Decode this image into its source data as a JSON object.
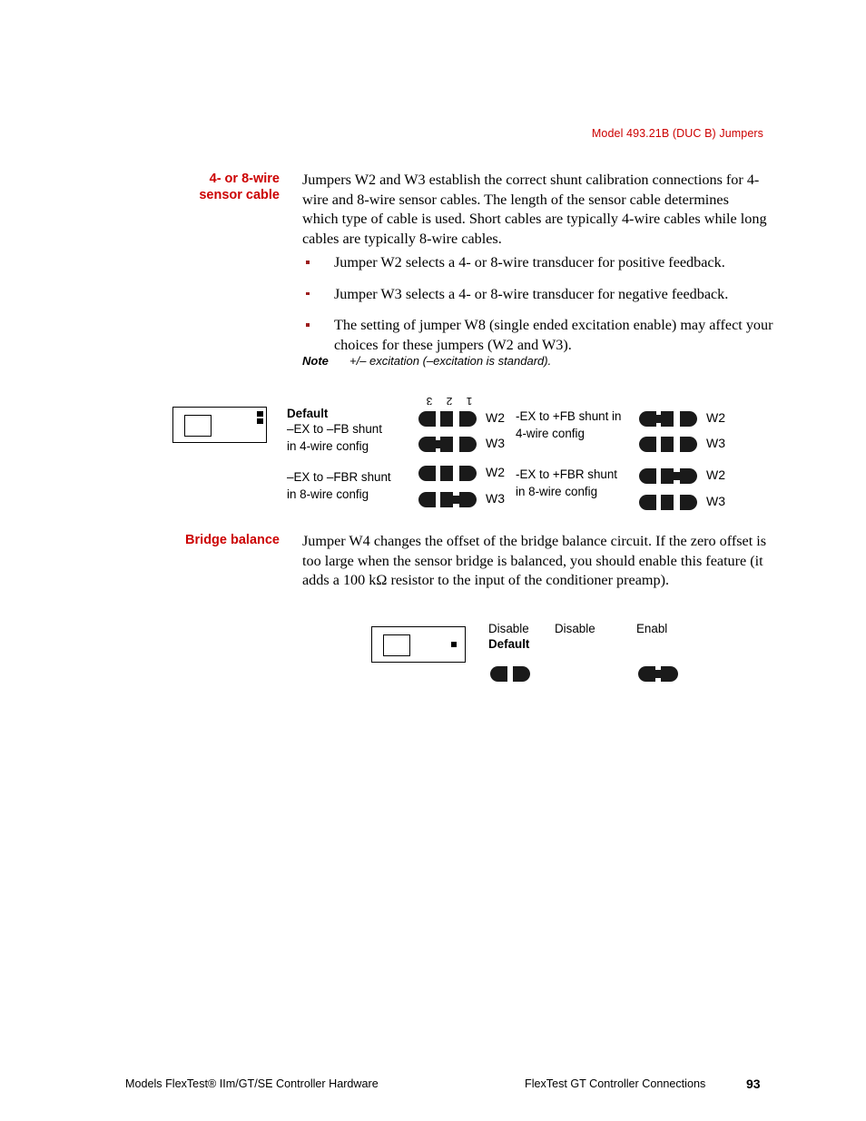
{
  "running_head": "Model 493.21B (DUC B) Jumpers",
  "sections": [
    {
      "heading": "4- or 8-wire\nsensor cable",
      "paragraph": "Jumpers W2 and W3 establish the correct shunt calibration connections for 4-wire and 8-wire sensor cables. The length of the sensor cable determines which type of cable is used. Short cables are typically 4-wire cables while long cables are typically 8-wire cables."
    },
    {
      "heading": "Bridge balance",
      "paragraph": "Jumper W4 changes the offset of the bridge balance circuit. If the zero offset is too large when the sensor bridge is balanced, you should enable this feature (it adds a 100 kΩ resistor to the input of the conditioner preamp)."
    }
  ],
  "bullets": [
    "Jumper W2 selects a 4- or 8-wire transducer for positive feedback.",
    "Jumper W3 selects a 4- or 8-wire transducer for negative feedback.",
    "The setting of jumper W8 (single ended excitation enable) may affect your choices for these jumpers (W2 and W3)."
  ],
  "note": {
    "label": "Note",
    "text": "+/– excitation (–excitation is standard)."
  },
  "jumper_diagram": {
    "pin_numbers": [
      "3",
      "2",
      "1"
    ],
    "left_column": {
      "group1": {
        "title": "Default",
        "caption": "–EX to –FB shunt\nin 4-wire config",
        "rows": [
          {
            "label": "W2",
            "shunt": "none"
          },
          {
            "label": "W3",
            "shunt": "3-2"
          }
        ]
      },
      "group2": {
        "caption": "–EX to –FBR shunt\nin 8-wire config",
        "rows": [
          {
            "label": "W2",
            "shunt": "none"
          },
          {
            "label": "W3",
            "shunt": "2-1"
          }
        ]
      }
    },
    "right_column": {
      "group1": {
        "caption": "-EX to +FB shunt in\n4-wire config",
        "rows": [
          {
            "label": "W2",
            "shunt": "3-2"
          },
          {
            "label": "W3",
            "shunt": "none"
          }
        ]
      },
      "group2": {
        "caption": "-EX to +FBR shunt\nin 8-wire config",
        "rows": [
          {
            "label": "W2",
            "shunt": "2-1"
          },
          {
            "label": "W3",
            "shunt": "none"
          }
        ]
      }
    }
  },
  "bridge_diagram": {
    "labels": {
      "disable_default_line1": "Disable",
      "disable_default_line2": "Default",
      "disable": "Disable",
      "enable": "Enabl"
    }
  },
  "footer": {
    "left": "Models FlexTest® IIm/GT/SE Controller Hardware",
    "right": "FlexTest GT Controller Connections",
    "page": "93"
  }
}
